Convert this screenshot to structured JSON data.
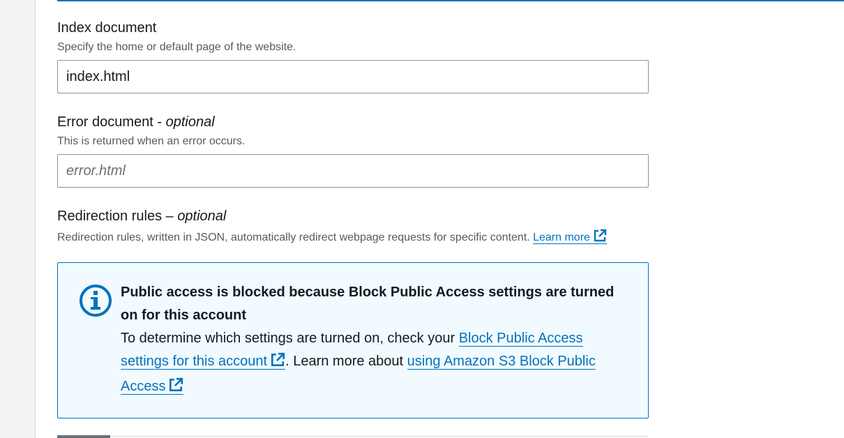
{
  "index_document": {
    "label": "Index document",
    "description": "Specify the home or default page of the website.",
    "value": "index.html"
  },
  "error_document": {
    "label": "Error document - ",
    "optional": "optional",
    "description": "This is returned when an error occurs.",
    "placeholder": "error.html"
  },
  "redirection_rules": {
    "label": "Redirection rules – ",
    "optional": "optional",
    "description": "Redirection rules, written in JSON, automatically redirect webpage requests for specific content.",
    "learn_more": "Learn more"
  },
  "alert": {
    "icon": "info-icon",
    "title": "Public access is blocked because Block Public Access settings are turned on for this account",
    "text_1": "To determine which settings are turned on, check your ",
    "link_1": "Block Public Access settings for this account",
    "text_2": ". Learn more about ",
    "link_2": "using Amazon S3 Block Public Access"
  },
  "colors": {
    "accent": "#0073bb",
    "alert_bg": "#f1faff"
  }
}
